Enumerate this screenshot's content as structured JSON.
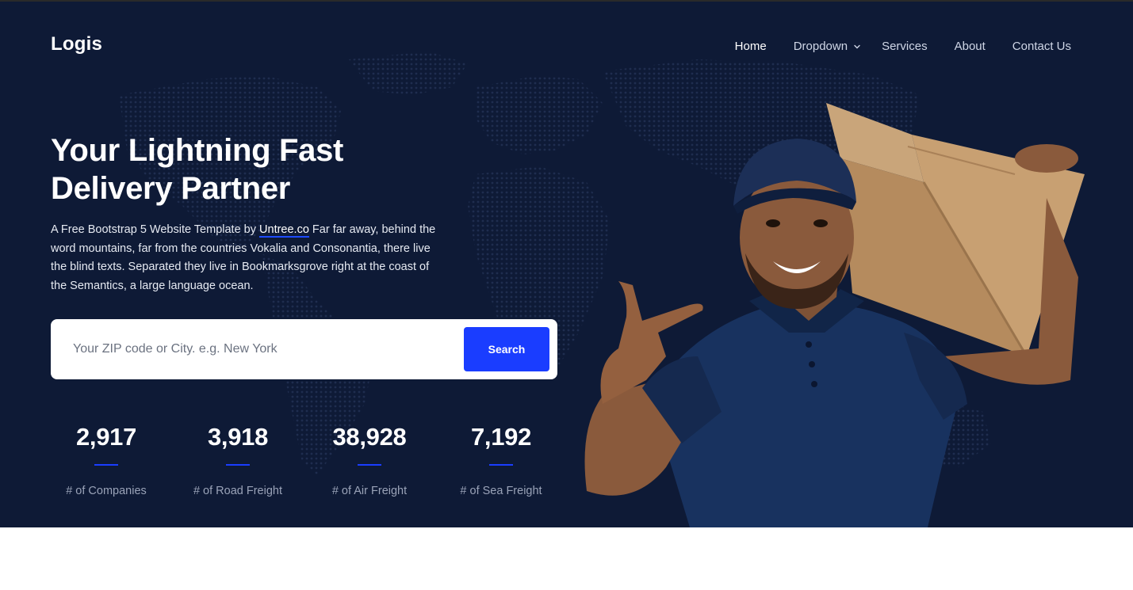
{
  "brand": {
    "logo": "Logis"
  },
  "nav": {
    "items": [
      {
        "label": "Home",
        "active": true
      },
      {
        "label": "Dropdown",
        "has_dropdown": true
      },
      {
        "label": "Services"
      },
      {
        "label": "About"
      },
      {
        "label": "Contact Us"
      }
    ]
  },
  "hero": {
    "headline_line1": "Your Lightning Fast",
    "headline_line2": "Delivery Partner",
    "lead_before_link": "A Free Bootstrap 5 Website Template by ",
    "lead_link": "Untree.co",
    "lead_after_link": " Far far away, behind the word mountains, far from the countries Vokalia and Consonantia, there live the blind texts. Separated they live in Bookmarksgrove right at the coast of the Semantics, a large language ocean."
  },
  "search": {
    "placeholder": "Your ZIP code or City. e.g. New York",
    "value": "",
    "button_label": "Search"
  },
  "stats": [
    {
      "number": "2,917",
      "label": "# of Companies"
    },
    {
      "number": "3,918",
      "label": "# of Road Freight"
    },
    {
      "number": "38,928",
      "label": "# of Air Freight"
    },
    {
      "number": "7,192",
      "label": "# of Sea Freight"
    }
  ],
  "colors": {
    "hero_background": "#0e1a36",
    "accent": "#1a3dff",
    "map_dots": "#1f2d4f"
  },
  "icons": {
    "dropdown": "chevron-down-icon",
    "hero_image": "delivery-man-with-box"
  }
}
